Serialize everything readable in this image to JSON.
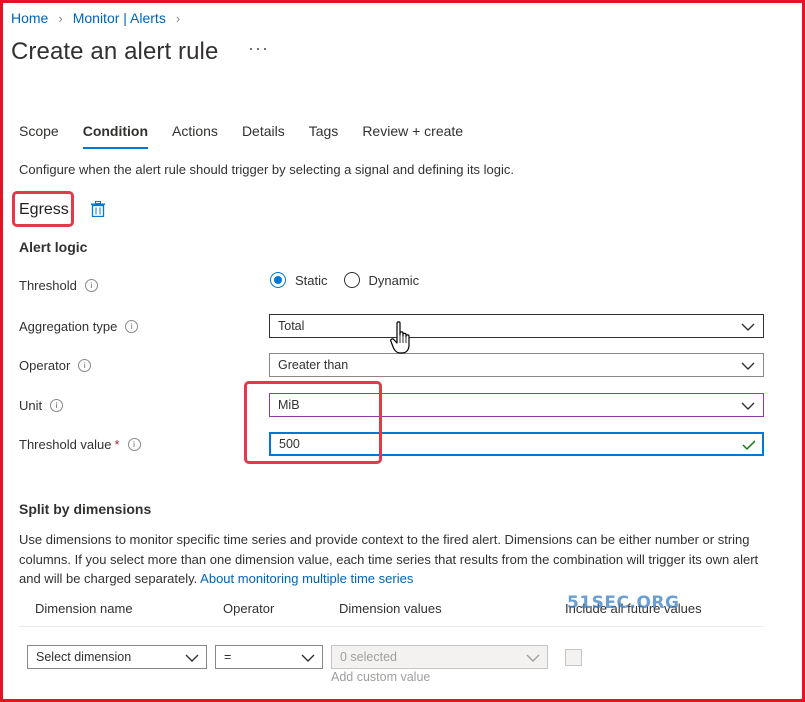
{
  "breadcrumb": {
    "home": "Home",
    "monitor": "Monitor | Alerts"
  },
  "page": {
    "title": "Create an alert rule",
    "more": "···"
  },
  "tabs": [
    {
      "label": "Scope",
      "active": false
    },
    {
      "label": "Condition",
      "active": true
    },
    {
      "label": "Actions",
      "active": false
    },
    {
      "label": "Details",
      "active": false
    },
    {
      "label": "Tags",
      "active": false
    },
    {
      "label": "Review + create",
      "active": false
    }
  ],
  "description": "Configure when the alert rule should trigger by selecting a signal and defining its logic.",
  "signal": {
    "name": "Egress",
    "delete_icon": "trash-icon"
  },
  "alert_logic": {
    "heading": "Alert logic",
    "threshold": {
      "label": "Threshold",
      "options": [
        "Static",
        "Dynamic"
      ],
      "selected": "Static"
    },
    "aggregation": {
      "label": "Aggregation type",
      "value": "Total"
    },
    "operator": {
      "label": "Operator",
      "value": "Greater than"
    },
    "unit": {
      "label": "Unit",
      "value": "MiB"
    },
    "threshold_value": {
      "label": "Threshold value",
      "required": "*",
      "value": "500"
    }
  },
  "split": {
    "heading": "Split by dimensions",
    "text": "Use dimensions to monitor specific time series and provide context to the fired alert. Dimensions can be either number or string columns. If you select more than one dimension value, each time series that results from the combination will trigger its own alert and will be charged separately.",
    "link": "About monitoring multiple time series",
    "columns": [
      "Dimension name",
      "Operator",
      "Dimension values",
      "Include all future values"
    ],
    "row": {
      "dimension_placeholder": "Select dimension",
      "operator": "=",
      "values_placeholder": "0 selected",
      "add_custom": "Add custom value"
    }
  },
  "watermark": "51SEC.ORG",
  "colors": {
    "accent": "#0078d4",
    "highlight": "#e23a4a",
    "link": "#0064b8"
  }
}
